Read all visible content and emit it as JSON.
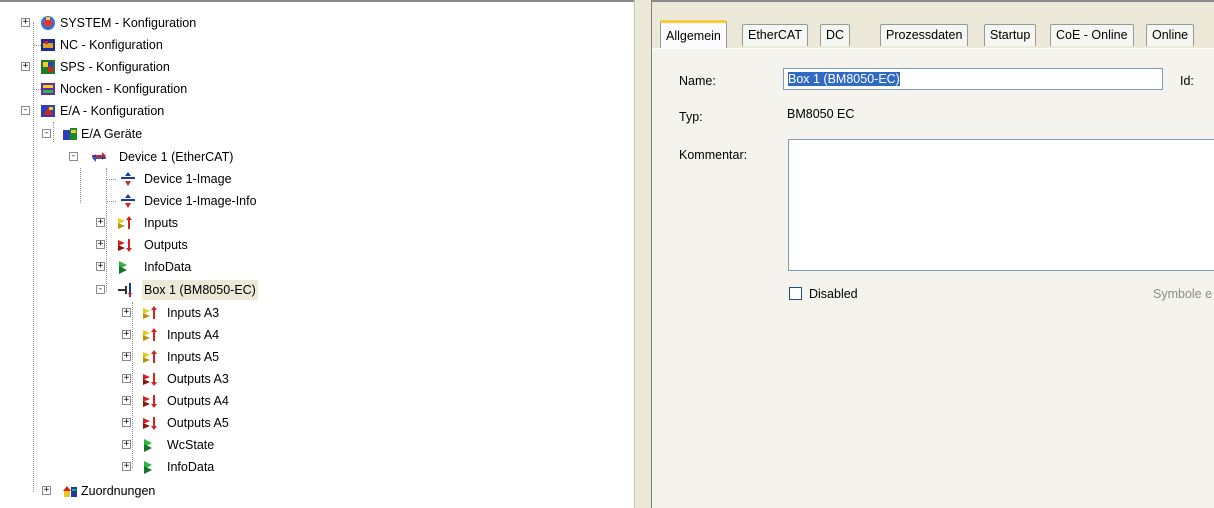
{
  "tree": {
    "items": [
      {
        "label": "SYSTEM - Konfiguration",
        "icon": "system-config-icon",
        "expander": "+"
      },
      {
        "label": "NC - Konfiguration",
        "icon": "nc-config-icon",
        "expander": ""
      },
      {
        "label": "SPS - Konfiguration",
        "icon": "plc-config-icon",
        "expander": "+"
      },
      {
        "label": "Nocken - Konfiguration",
        "icon": "cam-config-icon",
        "expander": ""
      },
      {
        "label": "E/A - Konfiguration",
        "icon": "io-config-icon",
        "expander": "-"
      },
      {
        "label": "E/A Geräte",
        "icon": "io-devices-icon",
        "expander": "-"
      },
      {
        "label": "Device 1 (EtherCAT)",
        "icon": "ethercat-device-icon",
        "expander": "-"
      },
      {
        "label": "Device 1-Image",
        "icon": "image-icon",
        "expander": ""
      },
      {
        "label": "Device 1-Image-Info",
        "icon": "image-info-icon",
        "expander": ""
      },
      {
        "label": "Inputs",
        "icon": "inputs-icon",
        "expander": "+"
      },
      {
        "label": "Outputs",
        "icon": "outputs-icon",
        "expander": "+"
      },
      {
        "label": "InfoData",
        "icon": "infodata-icon",
        "expander": "+"
      },
      {
        "label": "Box 1 (BM8050-EC)",
        "icon": "box-icon",
        "expander": "-"
      },
      {
        "label": "Inputs A3",
        "icon": "inputs-icon",
        "expander": "+"
      },
      {
        "label": "Inputs A4",
        "icon": "inputs-icon",
        "expander": "+"
      },
      {
        "label": "Inputs A5",
        "icon": "inputs-icon",
        "expander": "+"
      },
      {
        "label": "Outputs A3",
        "icon": "outputs-icon",
        "expander": "+"
      },
      {
        "label": "Outputs A4",
        "icon": "outputs-icon",
        "expander": "+"
      },
      {
        "label": "Outputs A5",
        "icon": "outputs-icon",
        "expander": "+"
      },
      {
        "label": "WcState",
        "icon": "wcstate-icon",
        "expander": "+"
      },
      {
        "label": "InfoData",
        "icon": "infodata-icon",
        "expander": "+"
      },
      {
        "label": "Zuordnungen",
        "icon": "mappings-icon",
        "expander": "+"
      }
    ]
  },
  "tabs": [
    "Allgemein",
    "EtherCAT",
    "DC",
    "Prozessdaten",
    "Startup",
    "CoE - Online",
    "Online"
  ],
  "form": {
    "name_label": "Name:",
    "name_value": "Box 1 (BM8050-EC)",
    "id_label": "Id:",
    "type_label": "Typ:",
    "type_value": "BM8050 EC",
    "comment_label": "Kommentar:",
    "comment_value": "",
    "disabled_label": "Disabled",
    "symbols_label": "Symbole e"
  },
  "colors": {
    "selection": "#316ac5",
    "active_tab_accent": "#ffc83c",
    "panel_bg": "#f4f3ee"
  }
}
